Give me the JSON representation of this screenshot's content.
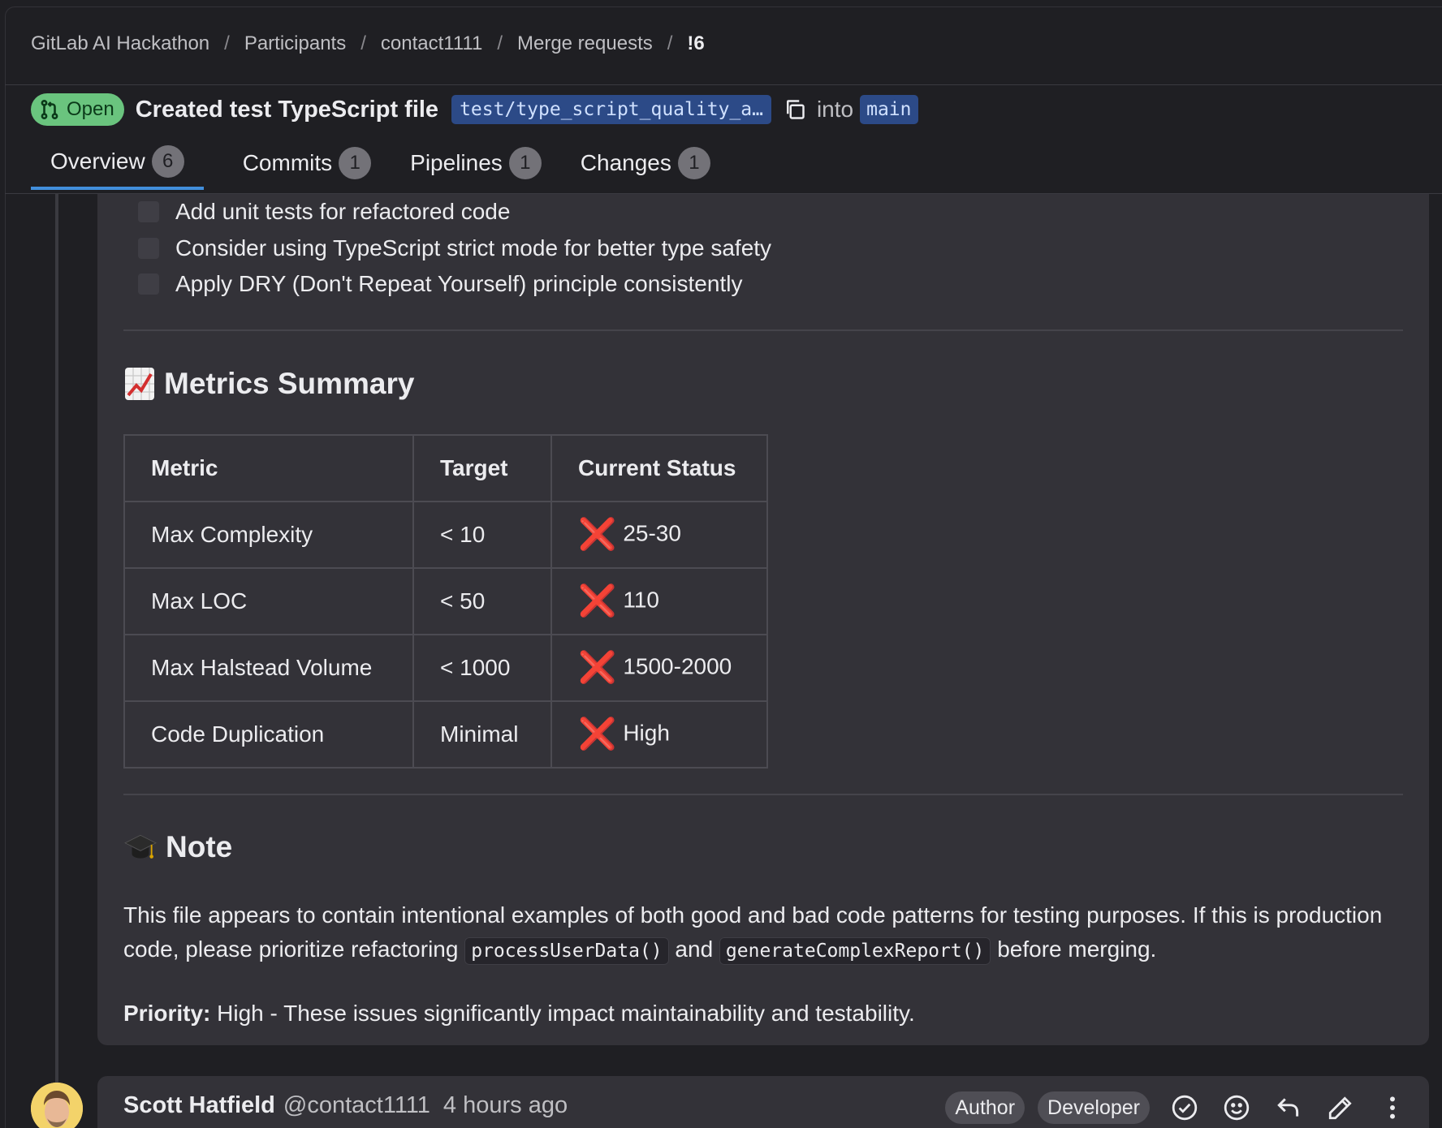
{
  "breadcrumb": {
    "items": [
      "GitLab AI Hackathon",
      "Participants",
      "contact1111",
      "Merge requests",
      "!6"
    ],
    "separator": "/"
  },
  "merge_request": {
    "status": "Open",
    "title": "Created test TypeScript file",
    "source_branch": "test/type_script_quality_a…",
    "into_label": "into",
    "target_branch": "main"
  },
  "tabs": [
    {
      "label": "Overview",
      "count": "6",
      "active": true
    },
    {
      "label": "Commits",
      "count": "1",
      "active": false
    },
    {
      "label": "Pipelines",
      "count": "1",
      "active": false
    },
    {
      "label": "Changes",
      "count": "1",
      "active": false
    }
  ],
  "checklist": [
    "Add unit tests for refactored code",
    "Consider using TypeScript strict mode for better type safety",
    "Apply DRY (Don't Repeat Yourself) principle consistently"
  ],
  "metrics_section": {
    "title": "Metrics Summary",
    "icon": "chart-increasing-icon",
    "headers": [
      "Metric",
      "Target",
      "Current Status"
    ],
    "rows": [
      {
        "metric": "Max Complexity",
        "target": "< 10",
        "status": "25-30"
      },
      {
        "metric": "Max LOC",
        "target": "< 50",
        "status": "110"
      },
      {
        "metric": "Max Halstead Volume",
        "target": "< 1000",
        "status": "1500-2000"
      },
      {
        "metric": "Code Duplication",
        "target": "Minimal",
        "status": "High"
      }
    ],
    "status_mark": "❌"
  },
  "note_section": {
    "title": "Note",
    "icon": "graduation-cap-icon",
    "paragraph_part1": "This file appears to contain intentional examples of both good and bad code patterns for testing purposes. If this is production code, please prioritize refactoring",
    "code1": "processUserData()",
    "paragraph_and": "and",
    "code2": "generateComplexReport()",
    "paragraph_part2": "before merging.",
    "priority_label": "Priority:",
    "priority_text": "High - These issues significantly impact maintainability and testability."
  },
  "comment": {
    "author": "Scott Hatfield",
    "handle": "@contact1111",
    "time": "4 hours ago",
    "badges": [
      "Author",
      "Developer"
    ]
  },
  "colors": {
    "background": "#1f1f23",
    "card": "#333238",
    "accent": "#428fdc",
    "open_badge": "#6ac47e",
    "branch_chip": "#2c4a87",
    "fail": "#e23a3a"
  }
}
